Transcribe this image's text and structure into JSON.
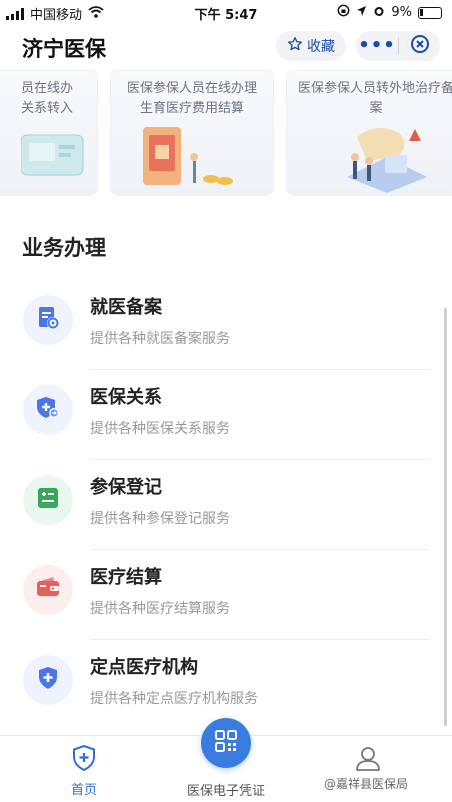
{
  "status_bar": {
    "carrier": "中国移动",
    "time": "下午 5:47",
    "battery": "9%",
    "icons": [
      "signal-icon",
      "wifi-icon",
      "lock-rotation-icon",
      "location-icon",
      "alarm-icon",
      "battery-icon"
    ]
  },
  "header": {
    "title": "济宁医保",
    "favorite_label": "收藏",
    "more_label": "•••"
  },
  "banners": [
    {
      "text": "员在线办 关系转入"
    },
    {
      "text": "医保参保人员在线办理生育医疗费用结算"
    },
    {
      "text": "医保参保人员转外地治疗备案"
    }
  ],
  "section_title": "业务办理",
  "services": [
    {
      "name": "就医备案",
      "desc": "提供各种就医备案服务",
      "icon": "document-settings-icon",
      "color": "#4a76e8",
      "bg": "#eef3ff"
    },
    {
      "name": "医保关系",
      "desc": "提供各种医保关系服务",
      "icon": "medical-shield-icon",
      "color": "#4a76e8",
      "bg": "#eef3ff"
    },
    {
      "name": "参保登记",
      "desc": "提供各种参保登记服务",
      "icon": "registration-card-icon",
      "color": "#36a85a",
      "bg": "#eaf7ee"
    },
    {
      "name": "医疗结算",
      "desc": "提供各种医疗结算服务",
      "icon": "wallet-icon",
      "color": "#e5605a",
      "bg": "#fdeeee"
    },
    {
      "name": "定点医疗机构",
      "desc": "提供各种定点医疗机构服务",
      "icon": "hospital-shield-icon",
      "color": "#4a76e8",
      "bg": "#eef3ff"
    }
  ],
  "tabbar": {
    "home_label": "首页",
    "qr_label": "医保电子凭证",
    "watermark": "@嘉祥县医保局"
  }
}
